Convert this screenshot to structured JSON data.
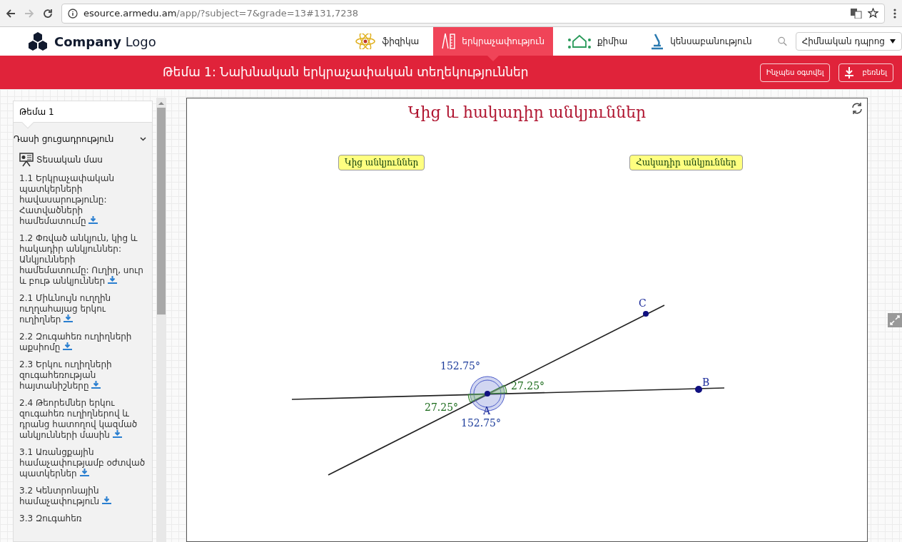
{
  "browser": {
    "url_host": "esource.armedu.am",
    "url_path": "/app/?subject=7&grade=13#131,7238"
  },
  "header": {
    "logo_bold": "Company",
    "logo_light": "Logo",
    "subjects": [
      {
        "label": "ֆիզիկա",
        "selected": false
      },
      {
        "label": "երկրաչափություն",
        "selected": true
      },
      {
        "label": "քիմիա",
        "selected": false
      },
      {
        "label": "կենսաբանություն",
        "selected": false
      }
    ],
    "school_select": "Հիմնական դպրոց"
  },
  "topic_bar": {
    "title": "Թեմա 1: Նախնական երկրաչափական տեղեկություններ",
    "help_button": "Ինչպես օգտվել",
    "download_button": "բեռնել"
  },
  "sidebar": {
    "topic": "Թեմա 1",
    "section": {
      "label": "Դասի ցուցադրություն",
      "expanded": true
    },
    "theory": "Տեսական մաս",
    "items": [
      {
        "label": "1.1 Երկրաչափական պատկերների հավասարությունը: Հատվածների համեմատումը",
        "download": true
      },
      {
        "label": "1.2 Փռված անկյուն, կից և հակադիր անկյուններ: Անկյունների համեմատումը: Ուղիղ, սուր և բութ անկյուններ",
        "download": true
      },
      {
        "label": "2.1 Միևնույն ուղղին ուղղահայաց երկու ուղիղներ",
        "download": true
      },
      {
        "label": "2.2 Զուգահեռ ուղիղների աքսիոմը",
        "download": true
      },
      {
        "label": "2.3 Երկու ուղիղների զուգահեռության հայտանիշները",
        "download": true
      },
      {
        "label": "2.4 Թեորեմներ երկու զուգահեռ ուղիղներով և դրանց հատողով կազմած անկյունների մասին",
        "download": true
      },
      {
        "label": "3.1 Առանցքային համաչափությամբ օժտված պատկերներ",
        "download": true
      },
      {
        "label": "3.2 Կենտրոնային համաչափություն",
        "download": true
      },
      {
        "label": "3.3 Զուգահեռ",
        "download": false
      }
    ]
  },
  "applet": {
    "title": "Կից և հակադիր անկյուններ",
    "buttons": [
      "Կից անկյուններ",
      "Հակադիր անկյուններ"
    ],
    "points": [
      "A",
      "B",
      "C"
    ],
    "angles": [
      {
        "label": "152.75°",
        "kind": "obtuse"
      },
      {
        "label": "152.75°",
        "kind": "obtuse"
      },
      {
        "label": "27.25°",
        "kind": "acute"
      },
      {
        "label": "27.25°",
        "kind": "acute"
      }
    ]
  }
}
